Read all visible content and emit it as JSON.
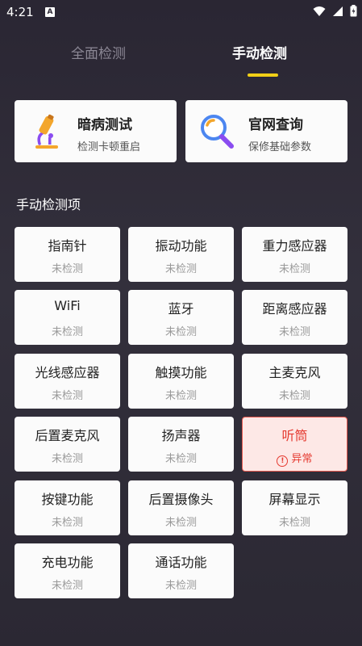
{
  "status_bar": {
    "time": "4:21",
    "badge": "A"
  },
  "tabs": {
    "all": "全面检测",
    "manual": "手动检测"
  },
  "features": [
    {
      "title": "暗病测试",
      "subtitle": "检测卡顿重启",
      "icon": "microscope-icon"
    },
    {
      "title": "官网查询",
      "subtitle": "保修基础参数",
      "icon": "magnifier-icon"
    }
  ],
  "section_title": "手动检测项",
  "items": [
    {
      "name": "指南针",
      "status": "未检测"
    },
    {
      "name": "振动功能",
      "status": "未检测"
    },
    {
      "name": "重力感应器",
      "status": "未检测"
    },
    {
      "name": "WiFi",
      "status": "未检测"
    },
    {
      "name": "蓝牙",
      "status": "未检测"
    },
    {
      "name": "距离感应器",
      "status": "未检测"
    },
    {
      "name": "光线感应器",
      "status": "未检测"
    },
    {
      "name": "触摸功能",
      "status": "未检测"
    },
    {
      "name": "主麦克风",
      "status": "未检测"
    },
    {
      "name": "后置麦克风",
      "status": "未检测"
    },
    {
      "name": "扬声器",
      "status": "未检测"
    },
    {
      "name": "听筒",
      "status": "异常"
    },
    {
      "name": "按键功能",
      "status": "未检测"
    },
    {
      "name": "后置摄像头",
      "status": "未检测"
    },
    {
      "name": "屏幕显示",
      "status": "未检测"
    },
    {
      "name": "充电功能",
      "status": "未检测"
    },
    {
      "name": "通话功能",
      "status": "未检测"
    }
  ],
  "colors": {
    "accent": "#f1cf17",
    "error": "#e53a30"
  }
}
